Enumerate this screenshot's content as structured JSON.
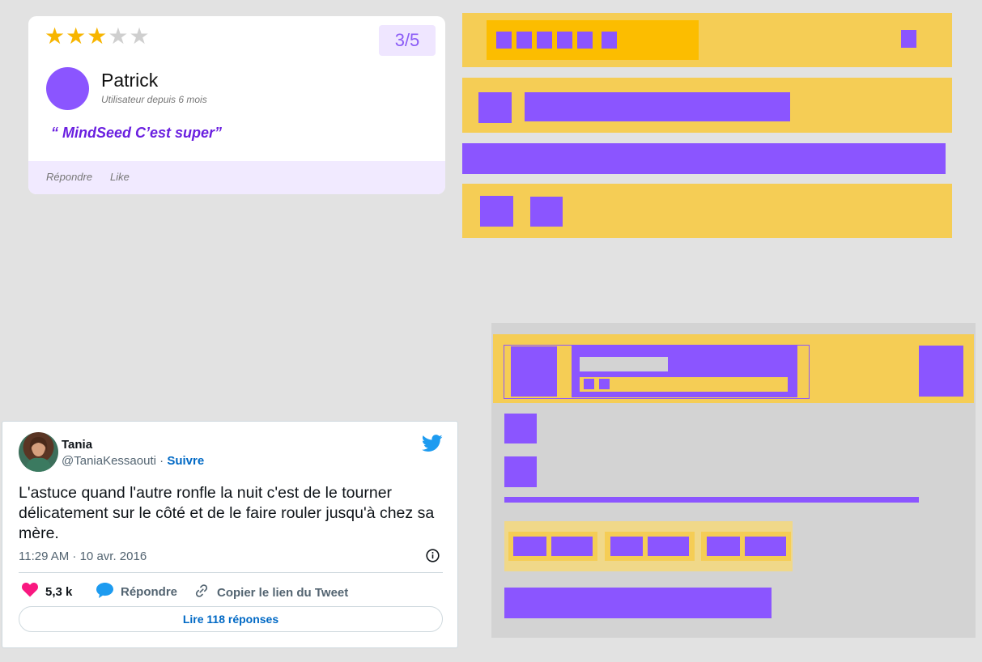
{
  "review": {
    "rating_value": 3,
    "rating_max": 5,
    "score_label": "3/5",
    "name": "Patrick",
    "meta": "Utilisateur depuis 6 mois",
    "quote": "“ MindSeed C’est super”",
    "actions": {
      "reply": "Répondre",
      "like": "Like"
    },
    "colors": {
      "accent": "#8b55ff",
      "quote": "#6a1fe0",
      "star": "#f7b500",
      "footer_bg": "#f1eaff"
    }
  },
  "wireframe_colors": {
    "block": "#f5cd55",
    "element": "#8b55ff",
    "highlight": "#fcbd00",
    "panel": "#d3d3d3"
  },
  "tweet": {
    "author_name": "Tania",
    "handle": "@TaniaKessaouti",
    "separator": " · ",
    "follow": "Suivre",
    "text": "L'astuce quand l'autre ronfle la nuit c'est de le tourner délicatement sur le côté et de le faire rouler jusqu'à chez sa mère.",
    "timestamp": "11:29 AM · 10 avr. 2016",
    "likes": "5,3 k",
    "reply": "Répondre",
    "copy_link": "Copier le lien du Tweet",
    "read_replies": "Lire 118 réponses",
    "icons": [
      "twitter-bird-icon",
      "info-icon",
      "heart-icon",
      "reply-bubble-icon",
      "link-icon"
    ]
  }
}
